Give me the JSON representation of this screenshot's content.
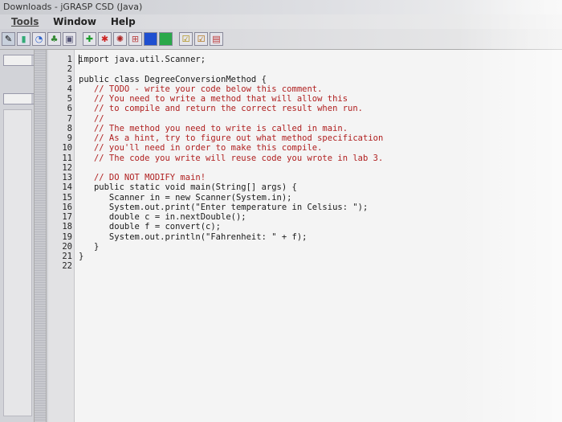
{
  "window": {
    "title": "Downloads - jGRASP CSD (Java)"
  },
  "menu": [
    "Tools",
    "Window",
    "Help"
  ],
  "toolbar": {
    "icons": [
      "pencil-icon",
      "chart-icon",
      "gauge-icon",
      "tree-icon",
      "book-icon",
      "green-plus-icon",
      "red-figure-icon",
      "bug-icon",
      "grid-icon",
      "blue-square-icon",
      "green-square-icon",
      "check-box-icon",
      "check-box-2-icon",
      "document-icon"
    ]
  },
  "editor": {
    "lines": [
      {
        "n": "1",
        "text": "import java.util.Scanner;",
        "kind": "code"
      },
      {
        "n": "2",
        "text": "",
        "kind": "code"
      },
      {
        "n": "3",
        "text": "public class DegreeConversionMethod {",
        "kind": "code"
      },
      {
        "n": "4",
        "text": "   // TODO - write your code below this comment.",
        "kind": "comment"
      },
      {
        "n": "5",
        "text": "   // You need to write a method that will allow this",
        "kind": "comment"
      },
      {
        "n": "6",
        "text": "   // to compile and return the correct result when run.",
        "kind": "comment"
      },
      {
        "n": "7",
        "text": "   //",
        "kind": "comment"
      },
      {
        "n": "8",
        "text": "   // The method you need to write is called in main.",
        "kind": "comment"
      },
      {
        "n": "9",
        "text": "   // As a hint, try to figure out what method specification",
        "kind": "comment"
      },
      {
        "n": "10",
        "text": "   // you'll need in order to make this compile.",
        "kind": "comment"
      },
      {
        "n": "11",
        "text": "   // The code you write will reuse code you wrote in lab 3.",
        "kind": "comment"
      },
      {
        "n": "12",
        "text": "",
        "kind": "code"
      },
      {
        "n": "13",
        "text": "   // DO NOT MODIFY main!",
        "kind": "comment"
      },
      {
        "n": "14",
        "text": "   public static void main(String[] args) {",
        "kind": "code"
      },
      {
        "n": "15",
        "text": "      Scanner in = new Scanner(System.in);",
        "kind": "code"
      },
      {
        "n": "16",
        "text": "      System.out.print(\"Enter temperature in Celsius: \");",
        "kind": "code"
      },
      {
        "n": "17",
        "text": "      double c = in.nextDouble();",
        "kind": "code"
      },
      {
        "n": "18",
        "text": "      double f = convert(c);",
        "kind": "code"
      },
      {
        "n": "19",
        "text": "      System.out.println(\"Fahrenheit: \" + f);",
        "kind": "code"
      },
      {
        "n": "20",
        "text": "   }",
        "kind": "code"
      },
      {
        "n": "21",
        "text": "}",
        "kind": "code"
      },
      {
        "n": "22",
        "text": "",
        "kind": "code"
      }
    ]
  }
}
